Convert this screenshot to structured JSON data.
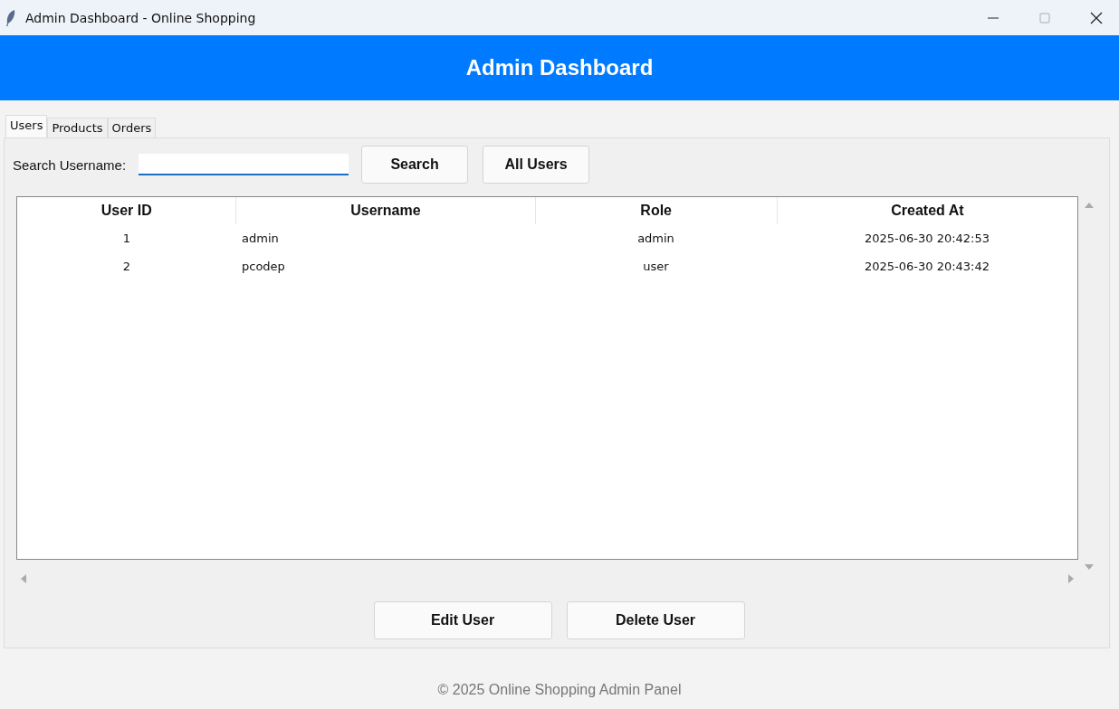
{
  "window": {
    "title": "Admin Dashboard - Online Shopping"
  },
  "header": {
    "title": "Admin Dashboard"
  },
  "tabs": [
    {
      "label": "Users",
      "selected": true
    },
    {
      "label": "Products",
      "selected": false
    },
    {
      "label": "Orders",
      "selected": false
    }
  ],
  "search": {
    "label": "Search Username:"
  },
  "buttons": [
    "Search",
    "All Users"
  ],
  "table": {
    "columns": [
      "User ID",
      "Username",
      "Role",
      "Created At"
    ],
    "rows": [
      [
        "1",
        "admin",
        "admin",
        "2025-06-30 20:42:53"
      ],
      [
        "2",
        "pcodep",
        "user",
        "2025-06-30 20:43:42"
      ]
    ]
  },
  "actions": [
    "Edit User",
    "Delete User"
  ],
  "footer": "© 2025 Online Shopping Admin Panel"
}
